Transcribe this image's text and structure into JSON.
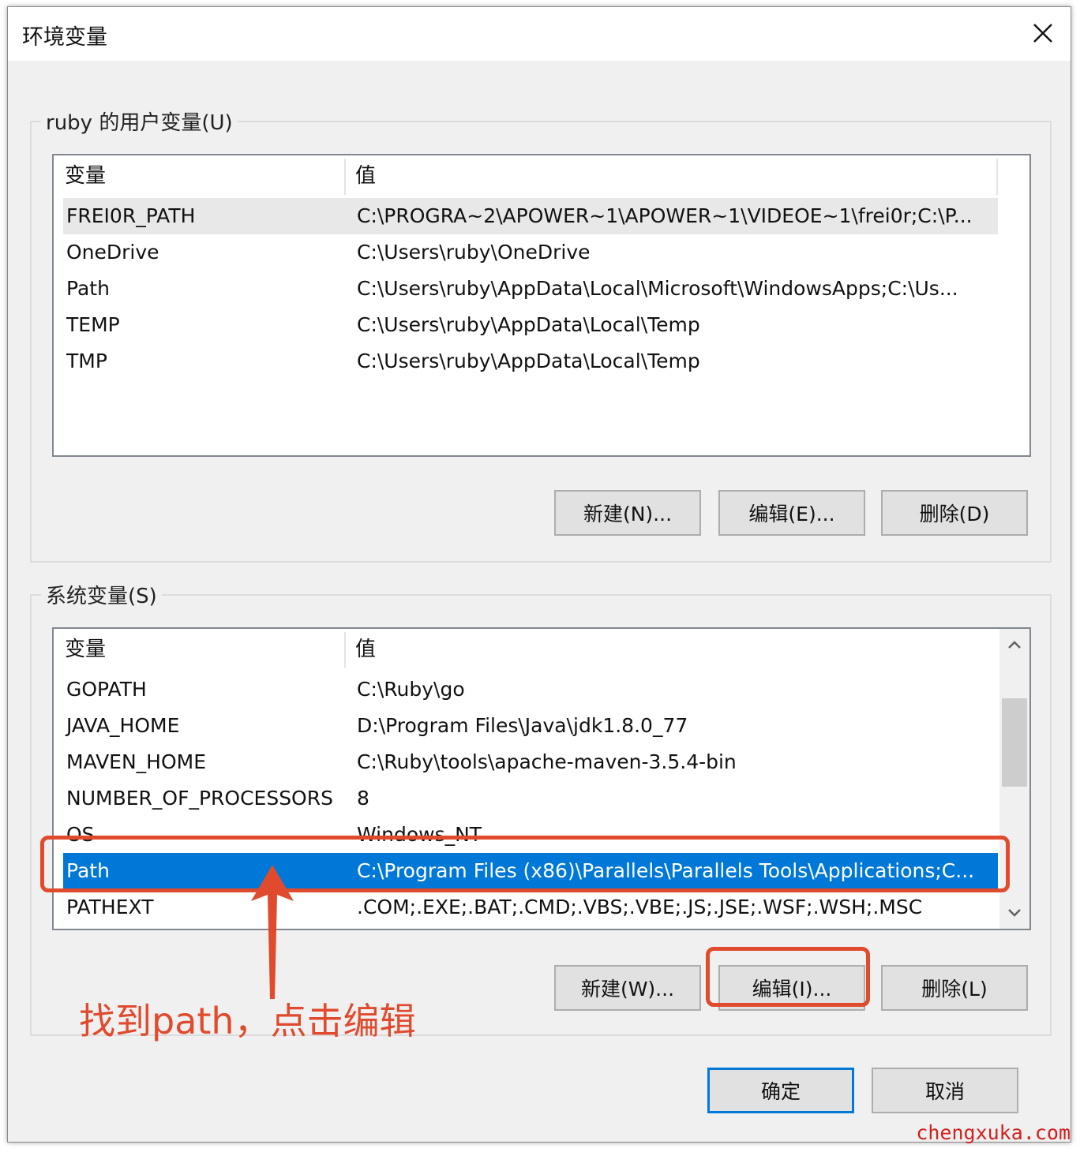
{
  "window": {
    "title": "环境变量",
    "close_glyph": "✕"
  },
  "user_vars": {
    "group_label": "ruby 的用户变量(U)",
    "headers": {
      "name": "变量",
      "value": "值"
    },
    "rows": [
      {
        "name": "FREI0R_PATH",
        "value": "C:\\PROGRA~2\\APOWER~1\\APOWER~1\\VIDEOE~1\\frei0r;C:\\P..."
      },
      {
        "name": "OneDrive",
        "value": "C:\\Users\\ruby\\OneDrive"
      },
      {
        "name": "Path",
        "value": "C:\\Users\\ruby\\AppData\\Local\\Microsoft\\WindowsApps;C:\\Us..."
      },
      {
        "name": "TEMP",
        "value": "C:\\Users\\ruby\\AppData\\Local\\Temp"
      },
      {
        "name": "TMP",
        "value": "C:\\Users\\ruby\\AppData\\Local\\Temp"
      }
    ],
    "buttons": {
      "new": "新建(N)...",
      "edit": "编辑(E)...",
      "delete": "删除(D)"
    }
  },
  "system_vars": {
    "group_label": "系统变量(S)",
    "headers": {
      "name": "变量",
      "value": "值"
    },
    "rows": [
      {
        "name": "GOPATH",
        "value": "C:\\Ruby\\go"
      },
      {
        "name": "JAVA_HOME",
        "value": "D:\\Program Files\\Java\\jdk1.8.0_77"
      },
      {
        "name": "MAVEN_HOME",
        "value": "C:\\Ruby\\tools\\apache-maven-3.5.4-bin"
      },
      {
        "name": "NUMBER_OF_PROCESSORS",
        "value": "8"
      },
      {
        "name": "OS",
        "value": "Windows_NT"
      },
      {
        "name": "Path",
        "value": "C:\\Program Files (x86)\\Parallels\\Parallels Tools\\Applications;C..."
      },
      {
        "name": "PATHEXT",
        "value": ".COM;.EXE;.BAT;.CMD;.VBS;.VBE;.JS;.JSE;.WSF;.WSH;.MSC"
      }
    ],
    "selected_row": "Path",
    "buttons": {
      "new": "新建(W)...",
      "edit": "编辑(I)...",
      "delete": "删除(L)"
    }
  },
  "footer": {
    "ok": "确定",
    "cancel": "取消"
  },
  "annotation": {
    "text": "找到path，点击编辑",
    "color": "#e04a2d"
  },
  "watermark": "chengxuka.com",
  "colors": {
    "selection": "#0078d7",
    "dialog_bg": "#f0f0f0"
  }
}
